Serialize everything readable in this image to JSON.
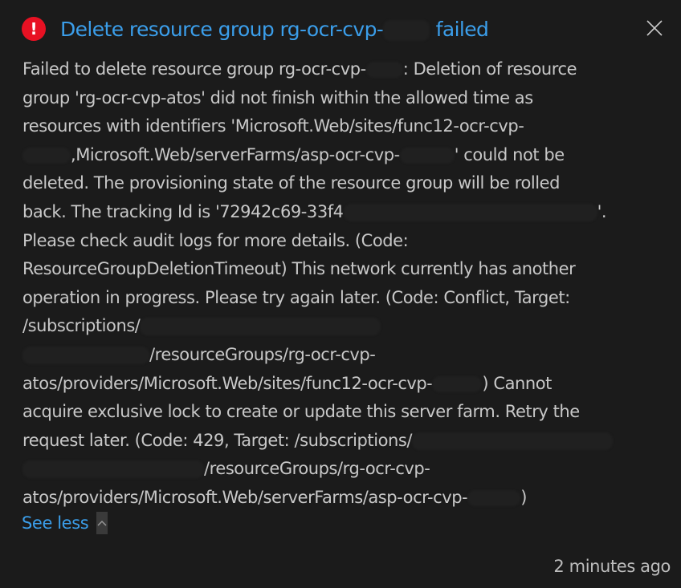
{
  "notification": {
    "title_prefix": "Delete resource group rg-ocr-cvp-",
    "title_suffix": " failed",
    "severity_icon": "error-icon",
    "close_icon": "close-icon",
    "message_lines": [
      "Failed to delete resource group rg-ocr-cvp-",
      ": Deletion of resource",
      "group 'rg-ocr-cvp-atos' did not finish within the allowed time as",
      "resources with identifiers 'Microsoft.Web/sites/func12-ocr-cvp-",
      ",Microsoft.Web/serverFarms/asp-ocr-cvp-",
      "' could not be",
      "deleted. The provisioning state of the resource group will be rolled",
      "back. The tracking Id is '72942c69-33f4",
      "'.",
      "Please check audit logs for more details. (Code:",
      "ResourceGroupDeletionTimeout) This network currently has another",
      "operation in progress. Please try again later. (Code: Conflict, Target:",
      "/subscriptions/",
      "/resourceGroups/rg-ocr-cvp-",
      "atos/providers/Microsoft.Web/sites/func12-ocr-cvp-",
      ") Cannot",
      "acquire exclusive lock to create or update this server farm. Retry the",
      "request later. (Code: 429, Target: /subscriptions/",
      "/resourceGroups/rg-ocr-cvp-",
      "atos/providers/Microsoft.Web/serverFarms/asp-ocr-cvp-",
      ")"
    ],
    "see_less_label": "See less",
    "chevron_icon": "chevron-up-icon",
    "timestamp": "2 minutes ago",
    "colors": {
      "background": "#1b1b1b",
      "accent": "#3b9eea",
      "error": "#e81123",
      "text": "#c8c8c8"
    }
  }
}
